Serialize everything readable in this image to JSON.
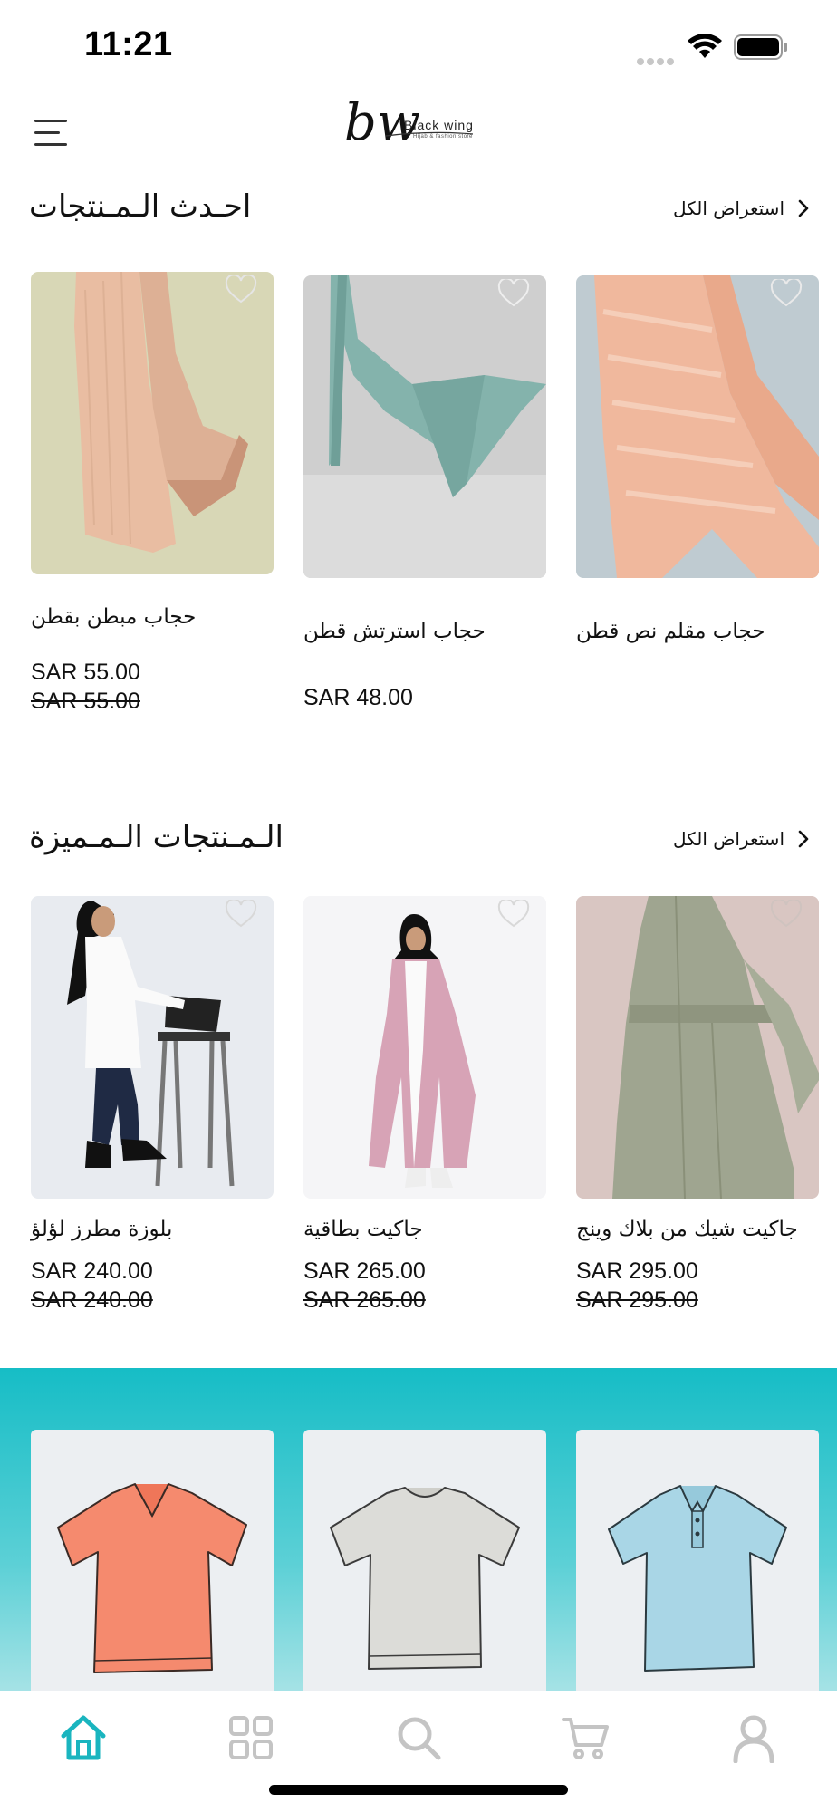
{
  "status_bar": {
    "time": "11:21"
  },
  "header": {
    "logo_mark": "bw",
    "logo_name": "Black wing",
    "logo_tagline": "Hijab & fashion store"
  },
  "latest": {
    "title": "احـدث الـمـنتجات",
    "view_all": "استعراض الكل",
    "products": [
      {
        "name": "حجاب مبطن بقطن",
        "price": "SAR 55.00",
        "old_price": "SAR 55.00"
      },
      {
        "name": "حجاب استرتش  قطن",
        "price": "SAR 48.00",
        "old_price": ""
      },
      {
        "name": "حجاب مقلم نص قطن",
        "price": "",
        "old_price": ""
      }
    ]
  },
  "featured": {
    "title": "الـمـنتجات الـمـميزة",
    "view_all": "استعراض الكل",
    "products": [
      {
        "name": "بلوزة مطرز لؤلؤ",
        "price": "SAR 240.00",
        "old_price": "SAR 240.00"
      },
      {
        "name": "جاكيت بطاقية",
        "price": "SAR 265.00",
        "old_price": "SAR 265.00"
      },
      {
        "name": "جاكيت شيك من بلاك وينج",
        "price": "SAR 295.00",
        "old_price": "SAR 295.00"
      }
    ]
  },
  "categories_banner": {
    "shirts": [
      {
        "icon": "orange-vneck-tshirt-icon",
        "color": "#f58a6e"
      },
      {
        "icon": "gray-tshirt-icon",
        "color": "#dcdcd8"
      },
      {
        "icon": "blue-polo-shirt-icon",
        "color": "#a9d6e6"
      }
    ],
    "gradient_top": "#16bdc6"
  },
  "tab_bar": {
    "tabs": [
      {
        "icon": "home-icon",
        "active": true
      },
      {
        "icon": "grid-icon",
        "active": false
      },
      {
        "icon": "search-icon",
        "active": false
      },
      {
        "icon": "cart-icon",
        "active": false
      },
      {
        "icon": "profile-icon",
        "active": false
      }
    ],
    "active_color": "#1ab5bf",
    "inactive_color": "#c4c4c4"
  }
}
